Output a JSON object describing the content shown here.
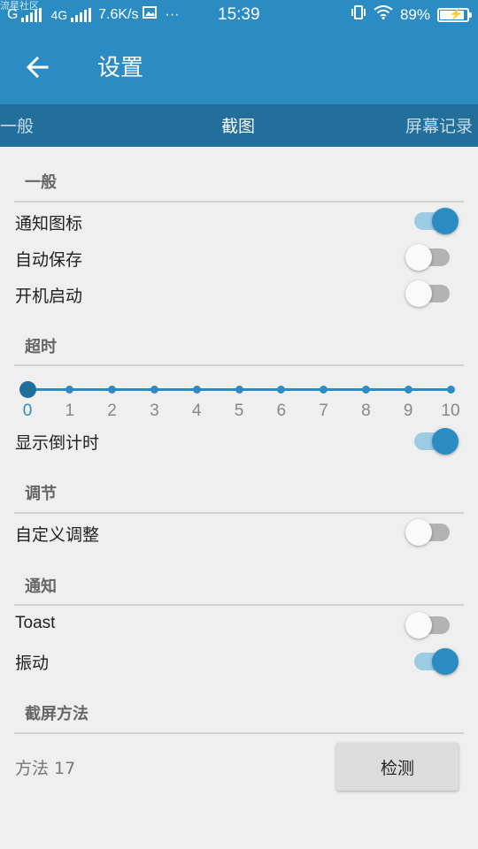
{
  "status_bar": {
    "watermark": "流星社区",
    "carrier1": "G",
    "carrier2": "4G",
    "net_speed": "7.6K/s",
    "more": "···",
    "time": "15:39",
    "battery": "89%",
    "battery_level": 0.89
  },
  "app_bar": {
    "title": "设置",
    "back_icon": "arrow-left-icon"
  },
  "tabs": {
    "left": "一般",
    "center": "截图",
    "right": "屏幕记录"
  },
  "sections": {
    "general": {
      "header": "一般",
      "items": [
        {
          "label": "通知图标",
          "on": true
        },
        {
          "label": "自动保存",
          "on": false
        },
        {
          "label": "开机启动",
          "on": false
        }
      ]
    },
    "timeout": {
      "header": "超时",
      "slider_ticks": [
        "0",
        "1",
        "2",
        "3",
        "4",
        "5",
        "6",
        "7",
        "8",
        "9",
        "10"
      ],
      "slider_value": 0,
      "countdown_label": "显示倒计时",
      "countdown_on": true
    },
    "adjust": {
      "header": "调节",
      "items": [
        {
          "label": "自定义调整",
          "on": false
        }
      ]
    },
    "notify": {
      "header": "通知",
      "items": [
        {
          "label": "Toast",
          "on": false
        },
        {
          "label": "振动",
          "on": true
        }
      ]
    },
    "capture": {
      "header": "截屏方法",
      "method": "方法 17",
      "detect_button": "检测"
    }
  },
  "colors": {
    "primary": "#2b8cc4",
    "tab_bar": "#236f9b",
    "background": "#efefef"
  }
}
